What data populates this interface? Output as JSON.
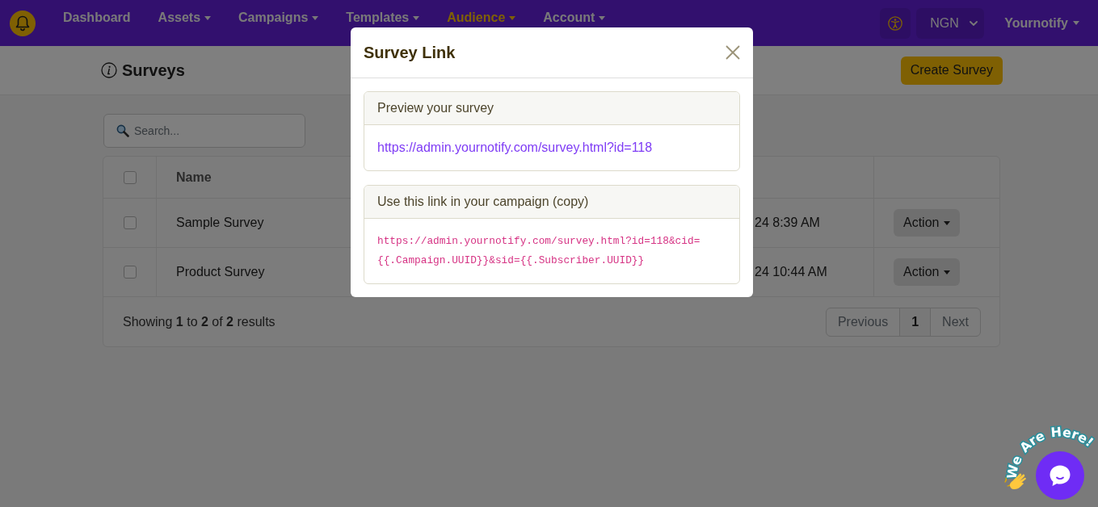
{
  "nav": {
    "items": [
      {
        "label": "Dashboard",
        "dropdown": false,
        "selected": false
      },
      {
        "label": "Assets",
        "dropdown": true,
        "selected": false
      },
      {
        "label": "Campaigns",
        "dropdown": true,
        "selected": false
      },
      {
        "label": "Templates",
        "dropdown": true,
        "selected": false
      },
      {
        "label": "Audience",
        "dropdown": true,
        "selected": true
      },
      {
        "label": "Account",
        "dropdown": true,
        "selected": false
      }
    ],
    "currency": "NGN",
    "account_menu": "Yournotify"
  },
  "page_header": {
    "title": "Surveys",
    "create_button": "Create Survey"
  },
  "search": {
    "placeholder": "Search..."
  },
  "table": {
    "select_all_checked": false,
    "columns": [
      {
        "label": "Name"
      }
    ],
    "rows": [
      {
        "checked": false,
        "name": "Sample Survey",
        "column_4": "24 8:39 AM",
        "action": "Action"
      },
      {
        "checked": false,
        "name": "Product Survey",
        "column_4": "24 10:44 AM",
        "action": "Action"
      }
    ],
    "summary": "Showing **1** to **2** of **2** results",
    "pagination": [
      {
        "label": "Previous",
        "selected": false
      },
      {
        "label": "1",
        "selected": true
      },
      {
        "label": "Next",
        "selected": false
      }
    ]
  },
  "modal": {
    "title": "Survey Link",
    "sections": [
      {
        "heading": "Preview your survey",
        "kind": "link",
        "text": "https://admin.yournotify.com/survey.html?id=118"
      },
      {
        "heading": "Use this link in your campaign (copy)",
        "kind": "code",
        "text": "https://admin.yournotify.com/survey.html?id=118&cid={{.Campaign.UUID}}&sid={{.Subscriber.UUID}}"
      }
    ]
  },
  "chat_widget": {
    "badge_words": [
      "We",
      "Are",
      "Here!"
    ]
  }
}
